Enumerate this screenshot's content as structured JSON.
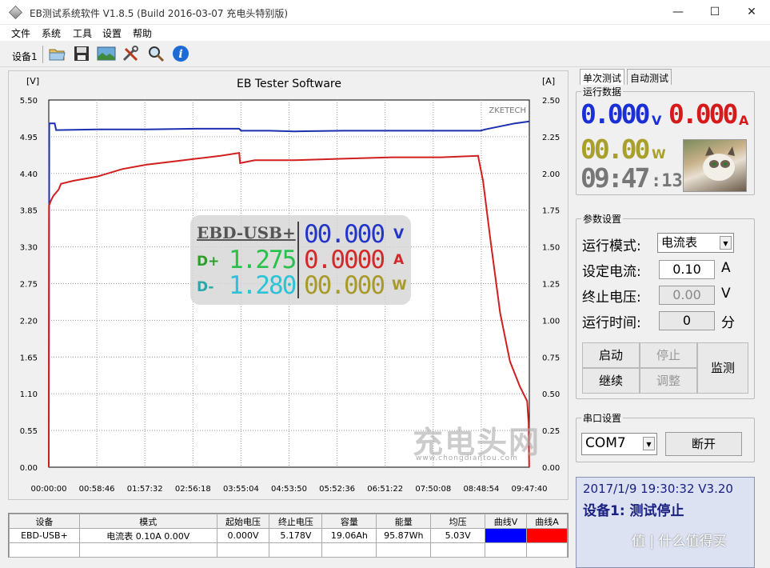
{
  "window": {
    "title": "EB测试系统软件 V1.8.5 (Build 2016-03-07 充电头特别版)"
  },
  "menu": [
    "文件",
    "系统",
    "工具",
    "设置",
    "帮助"
  ],
  "toolbar": {
    "device_tab": "设备1",
    "icons": [
      "open-folder-icon",
      "save-icon",
      "image-icon",
      "tools-icon",
      "search-icon",
      "info-icon"
    ]
  },
  "chart_data": {
    "type": "line",
    "title": "EB Tester Software",
    "ylabel_left": "[V]",
    "ylabel_right": "[A]",
    "brand": "ZKETECH",
    "x_ticks": [
      "00:00:00",
      "00:58:46",
      "01:57:32",
      "02:56:18",
      "03:55:04",
      "04:53:50",
      "05:52:36",
      "06:51:22",
      "07:50:08",
      "08:48:54",
      "09:47:40"
    ],
    "y_left_ticks": [
      "5.50",
      "4.95",
      "4.40",
      "3.85",
      "3.30",
      "2.75",
      "2.20",
      "1.65",
      "1.10",
      "0.55",
      "0.00"
    ],
    "y_right_ticks": [
      "2.50",
      "2.25",
      "2.00",
      "1.75",
      "1.50",
      "1.25",
      "1.00",
      "0.75",
      "0.50",
      "0.25",
      "0.00"
    ],
    "ylim_left": [
      0,
      5.5
    ],
    "ylim_right": [
      0,
      2.5
    ],
    "x_hours": [
      0,
      9.794
    ],
    "grid": true,
    "series": [
      {
        "name": "V",
        "color": "#1c2fb0",
        "axis": "left",
        "points": [
          [
            0,
            0
          ],
          [
            0.01,
            5.15
          ],
          [
            0.12,
            5.15
          ],
          [
            0.15,
            5.05
          ],
          [
            1.0,
            5.06
          ],
          [
            2.0,
            5.06
          ],
          [
            3.0,
            5.07
          ],
          [
            3.88,
            5.07
          ],
          [
            3.92,
            5.04
          ],
          [
            4.5,
            5.04
          ],
          [
            5.0,
            5.03
          ],
          [
            6.0,
            5.04
          ],
          [
            7.0,
            5.04
          ],
          [
            8.0,
            5.04
          ],
          [
            8.8,
            5.04
          ],
          [
            8.9,
            5.06
          ],
          [
            9.3,
            5.12
          ],
          [
            9.5,
            5.15
          ],
          [
            9.794,
            5.18
          ]
        ]
      },
      {
        "name": "A",
        "color": "#d11f1f",
        "axis": "right",
        "points": [
          [
            0,
            0
          ],
          [
            0.005,
            1.78
          ],
          [
            0.05,
            1.82
          ],
          [
            0.1,
            1.85
          ],
          [
            0.2,
            1.89
          ],
          [
            0.25,
            1.93
          ],
          [
            0.5,
            1.95
          ],
          [
            1.0,
            1.98
          ],
          [
            1.5,
            2.03
          ],
          [
            2.0,
            2.06
          ],
          [
            2.5,
            2.08
          ],
          [
            3.0,
            2.1
          ],
          [
            3.5,
            2.12
          ],
          [
            3.88,
            2.14
          ],
          [
            3.9,
            2.07
          ],
          [
            4.2,
            2.09
          ],
          [
            5.0,
            2.09
          ],
          [
            6.0,
            2.1
          ],
          [
            7.0,
            2.11
          ],
          [
            8.0,
            2.11
          ],
          [
            8.75,
            2.12
          ],
          [
            8.85,
            1.95
          ],
          [
            9.0,
            1.55
          ],
          [
            9.2,
            1.05
          ],
          [
            9.4,
            0.72
          ],
          [
            9.6,
            0.55
          ],
          [
            9.75,
            0.45
          ],
          [
            9.78,
            0.3
          ],
          [
            9.79,
            0
          ]
        ]
      }
    ]
  },
  "overlay": {
    "model": "EBD-USB+",
    "d_plus_label": "D+",
    "d_plus": "1.275",
    "d_minus_label": "D-",
    "d_minus": "1.280",
    "v": "00.000",
    "a": "0.0000",
    "w": "00.000",
    "u_v": "V",
    "u_a": "A",
    "u_w": "W"
  },
  "watermark": {
    "big": "充电头网",
    "small": "www.chongdiantou.com"
  },
  "table": {
    "headers": [
      "设备",
      "模式",
      "起始电压",
      "终止电压",
      "容量",
      "能量",
      "均压",
      "曲线V",
      "曲线A"
    ],
    "row": {
      "device": "EBD-USB+",
      "mode": "电流表  0.10A  0.00V",
      "start_v": "0.000V",
      "end_v": "5.178V",
      "capacity": "19.06Ah",
      "energy": "95.87Wh",
      "avg_v": "5.03V",
      "curve_v_color": "#0000ff",
      "curve_a_color": "#ff0000"
    }
  },
  "right": {
    "tabs": [
      "单次测试",
      "自动测试"
    ],
    "run_data_label": "运行数据",
    "voltage": "0.000",
    "voltage_unit": "V",
    "current": "0.000",
    "current_unit": "A",
    "power": "00.00",
    "power_unit": "W",
    "time_main": "09:47",
    "time_sec": ":13",
    "params_label": "参数设置",
    "mode_label": "运行模式:",
    "mode_value": "电流表",
    "set_current_label": "设定电流:",
    "set_current": "0.10",
    "set_current_unit": "A",
    "end_voltage_label": "终止电压:",
    "end_voltage": "0.00",
    "end_voltage_unit": "V",
    "run_time_label": "运行时间:",
    "run_time": "0",
    "run_time_unit": "分",
    "btn_start": "启动",
    "btn_stop": "停止",
    "btn_continue": "继续",
    "btn_adjust": "调整",
    "btn_monitor": "监测",
    "serial_label": "串口设置",
    "com_port": "COM7",
    "btn_disconnect": "断开",
    "status_line1": "2017/1/9 19:30:32  V3.20",
    "status_line2": "设备1: 测试停止"
  },
  "corner_logo": "值 | 什么值得买"
}
